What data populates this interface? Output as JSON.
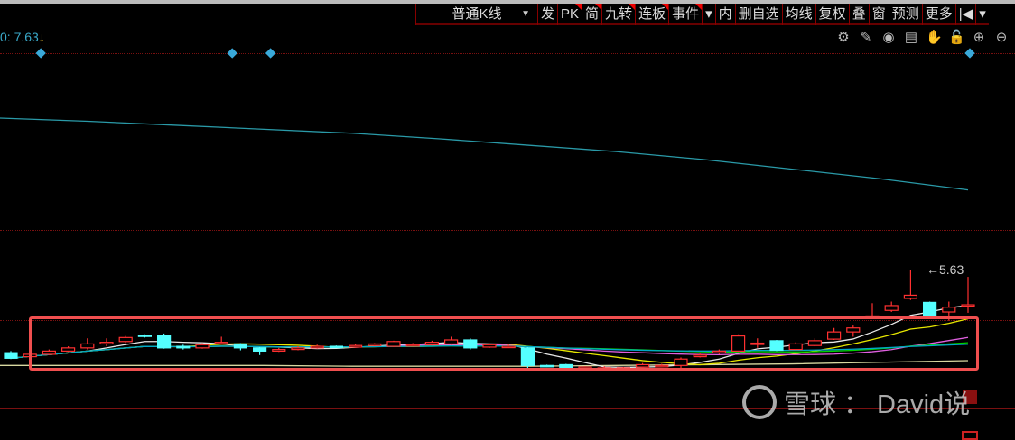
{
  "toolbar": {
    "period_label": "普通K线",
    "items": [
      {
        "label": "发",
        "flag": false
      },
      {
        "label": "PK",
        "flag": true
      },
      {
        "label": "简",
        "flag": true
      },
      {
        "label": "九转",
        "flag": true
      },
      {
        "label": "连板",
        "flag": true
      },
      {
        "label": "事件",
        "flag": true
      },
      {
        "label": "▾",
        "flag": false
      },
      {
        "label": "内",
        "flag": false
      },
      {
        "label": "删自选",
        "flag": false
      },
      {
        "label": "均线",
        "flag": false
      },
      {
        "label": "复权",
        "flag": false
      },
      {
        "label": "叠",
        "flag": false
      },
      {
        "label": "窗",
        "flag": false
      },
      {
        "label": "预测",
        "flag": false
      },
      {
        "label": "更多",
        "flag": false
      },
      {
        "label": "|◀",
        "flag": false
      },
      {
        "label": "▾",
        "flag": false
      }
    ]
  },
  "chart": {
    "max_label": "0: 7.63",
    "last_high_label": "5.63",
    "icons": [
      "gear-icon",
      "pen-icon",
      "eye-icon",
      "toolbox-icon",
      "hand-icon",
      "unlock-icon",
      "zoom-in-icon",
      "zoom-out-icon"
    ],
    "icon_glyphs": [
      "⚙",
      "✎",
      "◉",
      "▤",
      "✋",
      "🔓",
      "⊕",
      "⊖"
    ]
  },
  "watermark": {
    "brand": "雪球",
    "separator": "：",
    "author": "David说"
  },
  "colors": {
    "up": "#ff3030",
    "down": "#54ffff",
    "accent": "#f04f4f"
  },
  "chart_data": {
    "type": "candlestick",
    "ylim": [
      4.35,
      7.75
    ],
    "ohlc": [
      [
        4.6,
        4.53,
        4.62,
        4.52
      ],
      [
        4.55,
        4.58,
        4.6,
        4.54
      ],
      [
        4.58,
        4.62,
        4.64,
        4.57
      ],
      [
        4.62,
        4.66,
        4.68,
        4.61
      ],
      [
        4.66,
        4.71,
        4.78,
        4.64
      ],
      [
        4.71,
        4.73,
        4.78,
        4.68
      ],
      [
        4.74,
        4.79,
        4.81,
        4.72
      ],
      [
        4.82,
        4.81,
        4.83,
        4.79
      ],
      [
        4.82,
        4.66,
        4.84,
        4.65
      ],
      [
        4.68,
        4.66,
        4.7,
        4.64
      ],
      [
        4.66,
        4.7,
        4.72,
        4.65
      ],
      [
        4.72,
        4.73,
        4.8,
        4.7
      ],
      [
        4.71,
        4.66,
        4.72,
        4.63
      ],
      [
        4.66,
        4.62,
        4.67,
        4.57
      ],
      [
        4.62,
        4.64,
        4.66,
        4.61
      ],
      [
        4.64,
        4.66,
        4.68,
        4.63
      ],
      [
        4.66,
        4.68,
        4.7,
        4.65
      ],
      [
        4.68,
        4.67,
        4.69,
        4.66
      ],
      [
        4.67,
        4.69,
        4.71,
        4.66
      ],
      [
        4.69,
        4.71,
        4.72,
        4.68
      ],
      [
        4.68,
        4.74,
        4.75,
        4.67
      ],
      [
        4.7,
        4.7,
        4.72,
        4.68
      ],
      [
        4.7,
        4.73,
        4.75,
        4.69
      ],
      [
        4.71,
        4.76,
        4.8,
        4.7
      ],
      [
        4.76,
        4.66,
        4.78,
        4.64
      ],
      [
        4.67,
        4.7,
        4.72,
        4.66
      ],
      [
        4.68,
        4.68,
        4.7,
        4.67
      ],
      [
        4.66,
        4.44,
        4.67,
        4.4
      ],
      [
        4.44,
        4.43,
        4.45,
        4.42
      ],
      [
        4.45,
        4.41,
        4.46,
        4.4
      ],
      [
        4.4,
        4.42,
        4.43,
        4.39
      ],
      [
        4.41,
        4.41,
        4.43,
        4.4
      ],
      [
        4.4,
        4.41,
        4.42,
        4.4
      ],
      [
        4.42,
        4.45,
        4.47,
        4.41
      ],
      [
        4.44,
        4.44,
        4.46,
        4.43
      ],
      [
        4.44,
        4.52,
        4.54,
        4.4
      ],
      [
        4.55,
        4.57,
        4.59,
        4.54
      ],
      [
        4.6,
        4.62,
        4.64,
        4.58
      ],
      [
        4.62,
        4.81,
        4.83,
        4.61
      ],
      [
        4.72,
        4.72,
        4.78,
        4.66
      ],
      [
        4.75,
        4.63,
        4.76,
        4.62
      ],
      [
        4.64,
        4.71,
        4.73,
        4.63
      ],
      [
        4.69,
        4.75,
        4.78,
        4.68
      ],
      [
        4.77,
        4.86,
        4.91,
        4.76
      ],
      [
        4.86,
        4.91,
        4.94,
        4.8
      ],
      [
        5.05,
        5.06,
        5.22,
        5.04
      ],
      [
        5.13,
        5.19,
        5.24,
        5.11
      ],
      [
        5.28,
        5.32,
        5.63,
        5.26
      ],
      [
        5.23,
        5.07,
        5.24,
        5.04
      ],
      [
        5.11,
        5.17,
        5.24,
        5.0
      ],
      [
        5.2,
        5.2,
        5.55,
        5.1
      ]
    ],
    "long_ma": [
      7.54,
      7.5,
      7.45,
      7.4,
      7.35,
      7.28,
      7.2,
      7.12,
      7.02,
      6.9,
      6.78,
      6.64
    ],
    "base_line": [
      4.44,
      4.44,
      4.44,
      4.44,
      4.43,
      4.43,
      4.43,
      4.44,
      4.45,
      4.46,
      4.48,
      4.5
    ],
    "ma_periods": [
      5,
      10,
      20,
      30,
      60
    ],
    "ma_colors": [
      "#e8e8e8",
      "#e8e800",
      "#e060e0",
      "#00d000",
      "#00a8c8"
    ],
    "markers_index": [
      1,
      11,
      13,
      50
    ]
  }
}
